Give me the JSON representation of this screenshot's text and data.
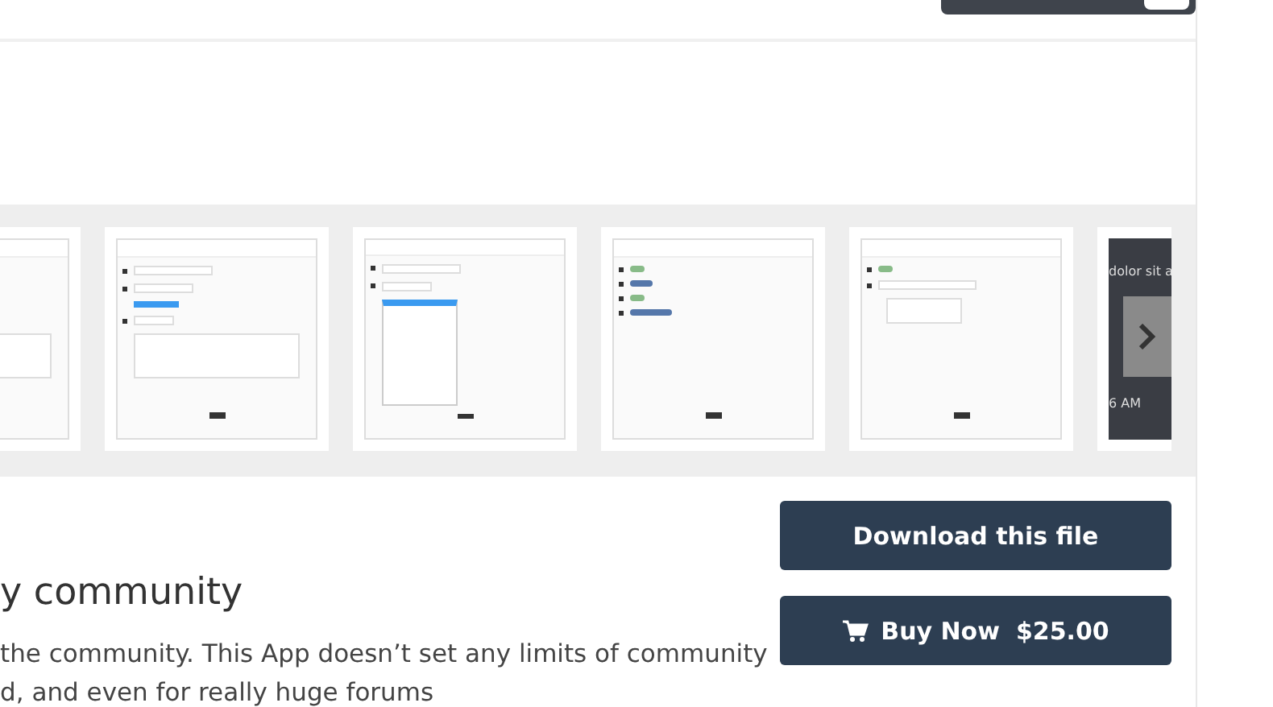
{
  "gallery": {
    "screenshots": [
      {
        "kind": "form"
      },
      {
        "kind": "form"
      },
      {
        "kind": "dropdown"
      },
      {
        "kind": "toggles"
      },
      {
        "kind": "autocomplete"
      },
      {
        "kind": "dark",
        "lines": [
          "dolor sit a",
          "6 AM"
        ]
      }
    ]
  },
  "heading": "y community",
  "description": [
    "the community. This App doesn’t set any limits of community",
    "d, and even for really huge forums"
  ],
  "buttons": [
    {
      "kind": "download",
      "label": "Download this file"
    },
    {
      "kind": "buy",
      "label": "Buy Now",
      "price": "$25.00"
    }
  ]
}
